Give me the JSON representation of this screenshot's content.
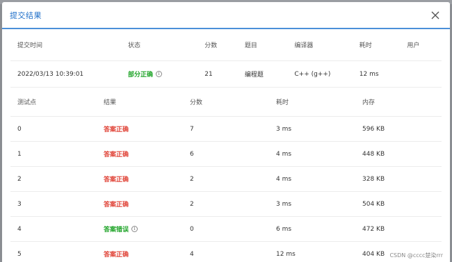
{
  "modal": {
    "title": "提交结果",
    "close_icon": "close-icon"
  },
  "summary": {
    "headers": [
      "提交时间",
      "状态",
      "分数",
      "题目",
      "编译器",
      "耗时",
      "用户"
    ],
    "row": {
      "time": "2022/03/13 10:39:01",
      "status": "部分正确",
      "score": "21",
      "problem": "编程题",
      "compiler": "C++ (g++)",
      "duration": "12 ms",
      "user": ""
    }
  },
  "tests": {
    "headers": [
      "测试点",
      "结果",
      "分数",
      "耗时",
      "内存"
    ],
    "rows": [
      {
        "point": "0",
        "result": "答案正确",
        "status": "correct",
        "score": "7",
        "time": "3 ms",
        "memory": "596 KB"
      },
      {
        "point": "1",
        "result": "答案正确",
        "status": "correct",
        "score": "6",
        "time": "4 ms",
        "memory": "448 KB"
      },
      {
        "point": "2",
        "result": "答案正确",
        "status": "correct",
        "score": "2",
        "time": "4 ms",
        "memory": "328 KB"
      },
      {
        "point": "3",
        "result": "答案正确",
        "status": "correct",
        "score": "2",
        "time": "3 ms",
        "memory": "504 KB"
      },
      {
        "point": "4",
        "result": "答案错误",
        "status": "wrong",
        "score": "0",
        "time": "6 ms",
        "memory": "472 KB"
      },
      {
        "point": "5",
        "result": "答案正确",
        "status": "correct",
        "score": "4",
        "time": "12 ms",
        "memory": "404 KB"
      }
    ]
  },
  "colors": {
    "accent": "#1f6fc9",
    "correct": "#e0463a",
    "partial": "#22a52b",
    "wrong": "#22a52b"
  },
  "watermark": "CSDN @cccc楚染rrr"
}
